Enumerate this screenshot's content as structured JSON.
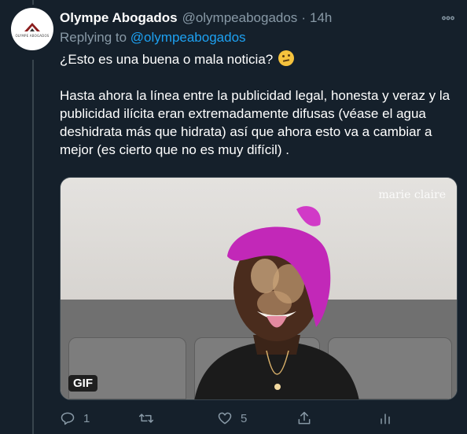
{
  "tweet": {
    "display_name": "Olympe Abogados",
    "handle": "@olympeabogados",
    "separator": "·",
    "time": "14h",
    "replying_prefix": "Replying to",
    "replying_to": "@olympeabogados",
    "paragraph_1": "¿Esto es una buena o mala noticia?",
    "paragraph_2": "Hasta ahora la línea entre la publicidad legal, honesta y veraz y la publicidad ilícita eran extremadamente difusas (véase el agua deshidrata más que hidrata) así que ahora esto va a cambiar a mejor (es cierto que no es muy difícil) .",
    "emoji": "thinking-face-emoji"
  },
  "avatar": {
    "logo_text": "OLYMPE ABOGADOS"
  },
  "media": {
    "brand_watermark": "marie claire",
    "badge": "GIF"
  },
  "actions": {
    "reply_count": "1",
    "retweet_count": "",
    "like_count": "5"
  },
  "colors": {
    "background": "#15202b",
    "text_primary": "#ffffff",
    "text_secondary": "#8899a6",
    "link": "#1da1f2",
    "border": "#38444d"
  }
}
